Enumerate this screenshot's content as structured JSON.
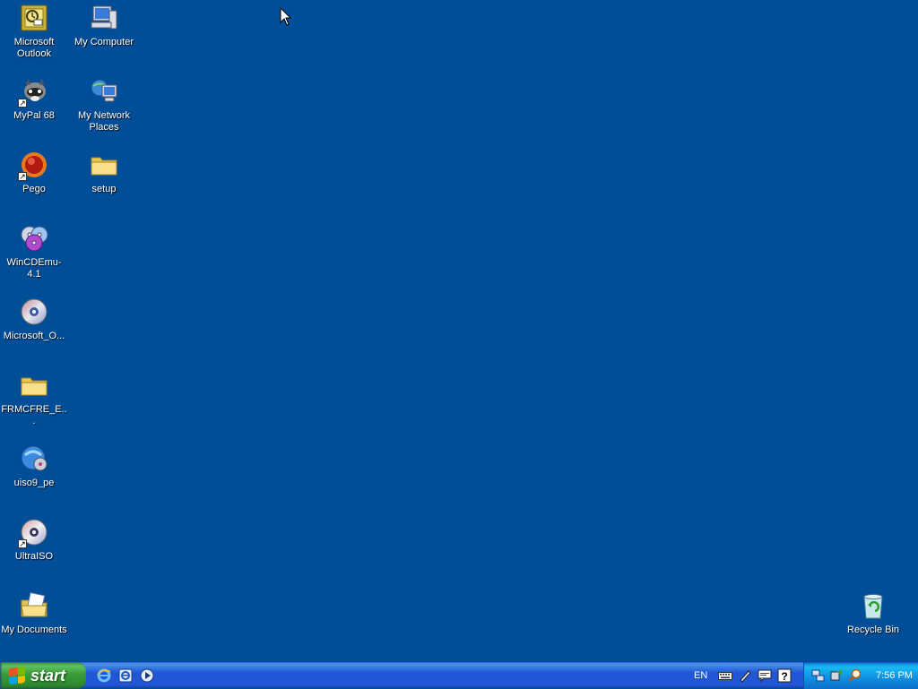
{
  "desktop": {
    "background_color": "#004e98",
    "icons": [
      {
        "label": "Microsoft Outlook",
        "icon": "outlook-icon",
        "shortcut": false
      },
      {
        "label": "My Computer",
        "icon": "my-computer-icon",
        "shortcut": false
      },
      {
        "label": "MyPal 68",
        "icon": "mypal-icon",
        "shortcut": true
      },
      {
        "label": "My Network Places",
        "icon": "network-places-icon",
        "shortcut": false
      },
      {
        "label": "Pego",
        "icon": "pego-icon",
        "shortcut": true
      },
      {
        "label": "setup",
        "icon": "folder-icon",
        "shortcut": false
      },
      {
        "label": "WinCDEmu-4.1",
        "icon": "wincdemu-icon",
        "shortcut": false
      },
      {
        "label": "Microsoft_O...",
        "icon": "disc-image-icon",
        "shortcut": false
      },
      {
        "label": "FRMCFRE_E...",
        "icon": "folder-icon",
        "shortcut": false
      },
      {
        "label": "uiso9_pe",
        "icon": "uiso-installer-icon",
        "shortcut": false
      },
      {
        "label": "UltraISO",
        "icon": "ultraiso-icon",
        "shortcut": true
      },
      {
        "label": "My Documents",
        "icon": "my-documents-icon",
        "shortcut": false
      },
      {
        "label": "Recycle Bin",
        "icon": "recycle-bin-icon",
        "shortcut": false
      }
    ]
  },
  "taskbar": {
    "start_label": "start",
    "quick_launch": [
      "internet-explorer-icon",
      "ie-alt-icon",
      "media-player-icon"
    ],
    "language": "EN",
    "tray_icons_left": [
      "keyboard-icon",
      "pen-icon",
      "speech-icon",
      "help-icon"
    ],
    "tray_icons": [
      "network-icon",
      "safely-remove-icon",
      "search-icon"
    ],
    "clock": "7:56 PM"
  }
}
